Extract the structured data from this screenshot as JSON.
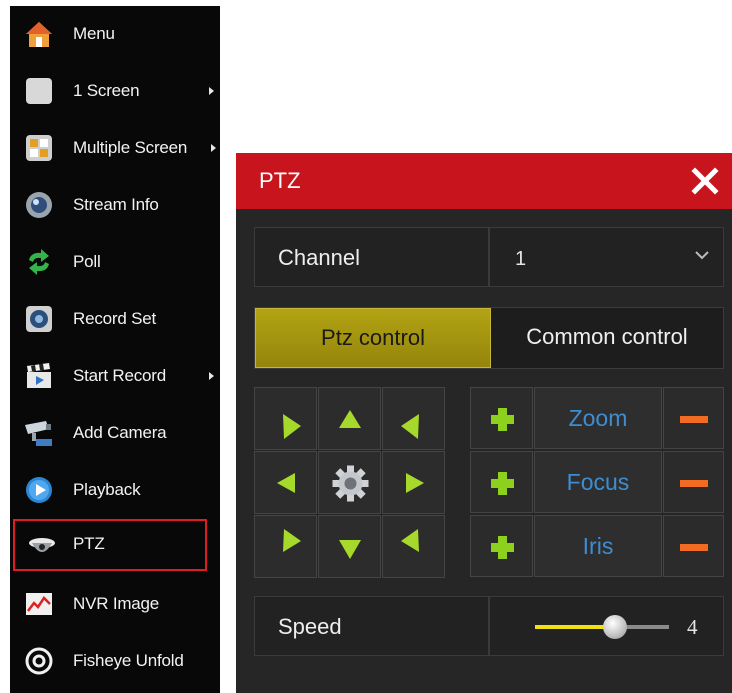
{
  "menu": {
    "items": [
      {
        "label": "Menu",
        "icon": "home-icon",
        "submenu": false,
        "selected": false
      },
      {
        "label": "1 Screen",
        "icon": "single-screen-icon",
        "submenu": true,
        "selected": false
      },
      {
        "label": "Multiple Screen",
        "icon": "multi-screen-icon",
        "submenu": true,
        "selected": false
      },
      {
        "label": "Stream Info",
        "icon": "stream-info-icon",
        "submenu": false,
        "selected": false
      },
      {
        "label": "Poll",
        "icon": "poll-icon",
        "submenu": false,
        "selected": false
      },
      {
        "label": "Record Set",
        "icon": "record-set-icon",
        "submenu": false,
        "selected": false
      },
      {
        "label": "Start Record",
        "icon": "clapper-icon",
        "submenu": true,
        "selected": false
      },
      {
        "label": "Add Camera",
        "icon": "camera-icon",
        "submenu": false,
        "selected": false
      },
      {
        "label": "Playback",
        "icon": "playback-icon",
        "submenu": false,
        "selected": false
      },
      {
        "label": "PTZ",
        "icon": "dome-camera-icon",
        "submenu": false,
        "selected": true
      },
      {
        "label": "NVR Image",
        "icon": "nvr-image-icon",
        "submenu": false,
        "selected": false
      },
      {
        "label": "Fisheye Unfold",
        "icon": "fisheye-icon",
        "submenu": false,
        "selected": false
      }
    ]
  },
  "ptz": {
    "title": "PTZ",
    "channel": {
      "label": "Channel",
      "value": "1"
    },
    "tabs": {
      "active": "Ptz control",
      "other": "Common control"
    },
    "lens": [
      {
        "name": "Zoom"
      },
      {
        "name": "Focus"
      },
      {
        "name": "Iris"
      }
    ],
    "speed": {
      "label": "Speed",
      "value": "4",
      "fraction": 0.6
    }
  },
  "colors": {
    "title_bar": "#c8141c",
    "active_tab": "#a89a12",
    "arrow": "#a6d92b",
    "plus": "#8ed11d",
    "minus": "#f26b22",
    "lens_text": "#3f8dd0",
    "slider_fill": "#f1e10f",
    "selection_border": "#e11b22"
  }
}
